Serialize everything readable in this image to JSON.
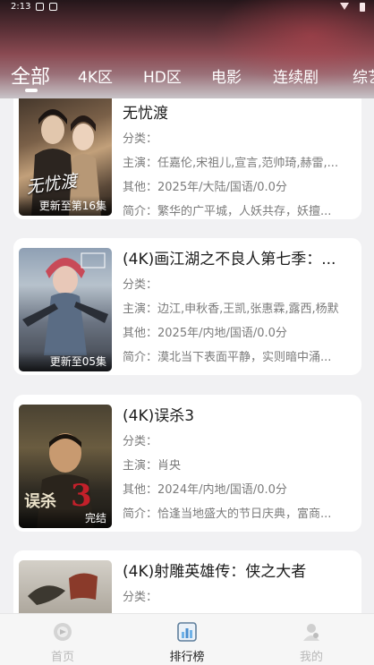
{
  "status_bar": {
    "time": "2:13"
  },
  "tabs": [
    {
      "label": "全部",
      "active": true
    },
    {
      "label": "4K区"
    },
    {
      "label": "HD区"
    },
    {
      "label": "电影"
    },
    {
      "label": "连续剧"
    },
    {
      "label": "综艺"
    }
  ],
  "field_labels": {
    "category": "分类：",
    "cast": "主演：",
    "other": "其他：",
    "intro": "简介："
  },
  "items": [
    {
      "title": "无忧渡",
      "poster_title": "无忧渡",
      "badge": "更新至第16集",
      "category": "",
      "cast": "任嘉伦,宋祖儿,宣言,范帅琦,赫雷,...",
      "other": "2025年/大陆/国语/0.0分",
      "intro": "繁华的广平城，人妖共存，妖擅..."
    },
    {
      "title": "(4K)画江湖之不良人第七季：...",
      "badge": "更新至05集",
      "category": "",
      "cast": "边江,申秋香,王凯,张惠霖,露西,杨默",
      "other": "2025年/内地/国语/0.0分",
      "intro": "漠北当下表面平静，实则暗中涌..."
    },
    {
      "title": "(4K)误杀3",
      "poster_title": "误杀",
      "badge": "完结",
      "category": "",
      "cast": "肖央",
      "other": "2024年/内地/国语/0.0分",
      "intro": "恰逢当地盛大的节日庆典，富商..."
    },
    {
      "title": "(4K)射雕英雄传：侠之大者",
      "category": ""
    }
  ],
  "bottom_nav": [
    {
      "label": "首页",
      "icon": "home-icon"
    },
    {
      "label": "排行榜",
      "icon": "ranking-icon",
      "active": true
    },
    {
      "label": "我的",
      "icon": "profile-icon"
    }
  ],
  "colors": {
    "active_text": "#222222",
    "inactive_text": "#b8b8b8",
    "header_accent": "#8a4a52"
  }
}
